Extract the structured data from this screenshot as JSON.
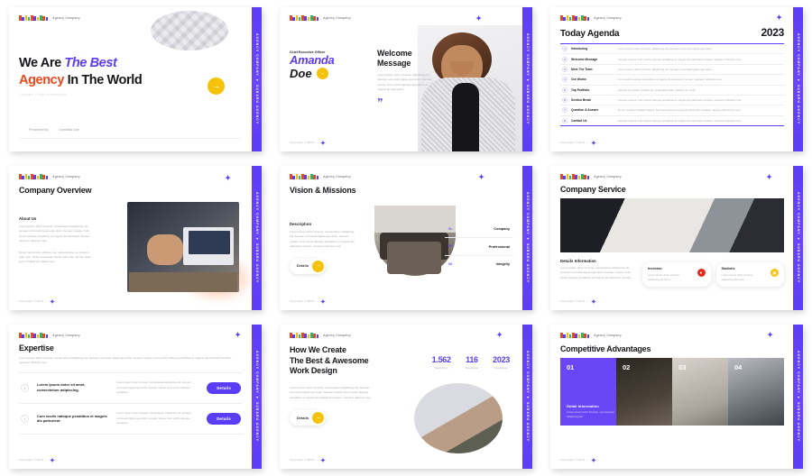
{
  "brand": {
    "name": "Agency Company",
    "logo_colors": [
      "#e8491f",
      "#5b3df5",
      "#f5c20b",
      "#2bb673",
      "#e8491f",
      "#5b3df5",
      "#f5c20b",
      "#2bb673",
      "#e8491f",
      "#5b3df5"
    ]
  },
  "rail": {
    "text": "AGENCY COMPANY  ✦  SUBARU AGENCY",
    "star": "✦",
    "color": "#5b3df5"
  },
  "common": {
    "copyright": "Copyright © 2023",
    "plus": "✦",
    "arrow": "→"
  },
  "slides": [
    {
      "id": "title-slide",
      "head_line1_a": "We Are ",
      "head_line1_b": "The Best",
      "head_line2_a": "Agency",
      "head_line2_b": " In The World",
      "subtitle": "Company Profile Presentation",
      "presented_label": "Presented by:",
      "presented_name": "Dominika Doe"
    },
    {
      "id": "welcome-slide",
      "role": "Chief Executive Officer",
      "first_name": "Amanda",
      "last_name": "Doe",
      "heading": "Welcome\nMessage",
      "body": "Lorem ipsum dolor sit amet, adipiscing elit, dolorem commodo ligula eget dolor. Aenean massa. Cum sociis natoque penatibus et magnis dis parturient.",
      "quote_glyph": "”"
    },
    {
      "id": "agenda-slide",
      "title": "Today Agenda",
      "year": "2023",
      "items": [
        {
          "n": "1",
          "label": "Introducing",
          "desc": "Lorem ipsum dolor sit amet, adipiscing elit, Aenean commodo ligula eget dolor."
        },
        {
          "n": "2",
          "label": "Welcome Message",
          "desc": "Aenean massa. Cum sociis natoque penatibus et magnis dis parturient montes, nascetur ridiculus mus."
        },
        {
          "n": "3",
          "label": "Meet The Team",
          "desc": "Lorem ipsum dolor sit amet, adipiscing elit, Aenean commodo ligula eget dolor."
        },
        {
          "n": "4",
          "label": "Our Works",
          "desc": "Cum sociis natoque penatibus et magnis dis parturient montes, nascetur ridiculus mus."
        },
        {
          "n": "5",
          "label": "Top Portfolio",
          "desc": "Aenean leo ligula, porttitor eu, consequat vitae, eleifend ac, enim."
        },
        {
          "n": "6",
          "label": "Section Break",
          "desc": "Aenean massa. Cum sociis natoque penatibus et magnis dis parturient montes, nascetur ridiculus mus."
        },
        {
          "n": "7",
          "label": "Question & Answer",
          "desc": "Donec sodales sagittis magna. Sed consequat leo egestas bibendum sodales, augue velit cursus nunc."
        },
        {
          "n": "8",
          "label": "Contact Us",
          "desc": "Aenean massa. Cum sociis natoque penatibus et magnis dis parturient montes, nascetur ridiculus mus."
        }
      ]
    },
    {
      "id": "company-overview-slide",
      "title": "Company Overview",
      "section": "About Us",
      "body1": "Lorem ipsum dolor sit amet, consectetuer adipiscing elit. Aenean commodo ligula eget dolor. Aenean massa. Cum sociis natoque penatibus et magnis dis parturient montes, nascetur ridiculus mus.",
      "body2": "Donec quam felis, ultricies nec, pellentesque eu, pretium quis, sem. Nulla consequat massa quis enim. Donec pede justo, fringilla vel, aliquet nec."
    },
    {
      "id": "vision-missions-slide",
      "title": "Vision & Missions",
      "section": "Description",
      "body": "Lorem ipsum dolor sit amet, consectetuer adipiscing elit. Aenean commodo ligula eget dolor. Aenean massa. Cum sociis natoque penatibus et magnis dis parturient montes, nascetur ridiculus mus.",
      "cta": "Details",
      "items": [
        {
          "n": "01.",
          "label": "Company"
        },
        {
          "n": "02.",
          "label": "Professional"
        },
        {
          "n": "03.",
          "label": "Integrity"
        }
      ]
    },
    {
      "id": "company-service-slide",
      "title": "Company Service",
      "section": "Details Information",
      "body": "Lorem ipsum dolor sit amet, consectetuer adipiscing elit. Aenean commodo ligula eget dolor. Aenean massa. Cum sociis natoque penatibus et magnis dis parturient montes.",
      "cards": [
        {
          "title": "Increase",
          "desc": "Lorem ipsum dolor sit amet, adipiscing elit lorem.",
          "icon": "flame-icon",
          "color": "#e8291f"
        },
        {
          "title": "Statistic",
          "desc": "Lorem ipsum dolor sit amet, adipiscing elit lorem.",
          "icon": "chart-icon",
          "color": "#f5c20b"
        }
      ]
    },
    {
      "id": "expertise-slide",
      "title": "Expertise",
      "intro": "Lorem ipsum dolor sit amet, consectetuer adipiscing elit. Aenean commodo ligula eget dolor. Aenean massa. Cum sociis natoque penatibus et magnis dis parturient montes, nascetur ridiculus mus.",
      "rows": [
        {
          "icon": "info-icon",
          "title": "Lorem ipsum dolor sit amet, consectetuer adipiscing.",
          "desc": "Lorem ipsum dolor sit amet, consectetuer adipiscing elit. Aenean commodo ligula eget dolor. Aenean massa. Cum sociis natoque penatibus.",
          "cta": "Details"
        },
        {
          "icon": "info-icon",
          "title": "Cum sociis natoque penatibus et magnis dis parturient.",
          "desc": "Lorem ipsum dolor sit amet, consectetuer adipiscing elit. Aenean commodo ligula eget dolor. Aenean massa. Cum sociis natoque penatibus.",
          "cta": "Details"
        }
      ]
    },
    {
      "id": "work-design-slide",
      "head1": "How We Create",
      "head2": "The Best & Awesome",
      "head3": "Work Design",
      "body": "Lorem ipsum dolor sit amet, consectetuer adipiscing elit. Aenean commodo ligula eget dolor. Aenean massa. Cum sociis natoque penatibus et magnis dis parturient montes, nascetur ridiculus mus.",
      "cta": "Details",
      "stats": [
        {
          "value": "1.562",
          "label": "Description"
        },
        {
          "value": "116",
          "label": "Description"
        },
        {
          "value": "2023",
          "label": "Description"
        }
      ]
    },
    {
      "id": "competitive-advantages-slide",
      "title": "Competitive Advantages",
      "panels": [
        {
          "n": "01",
          "info_title": "Detail Information",
          "info_body": "Lorem ipsum dolor sit amet, consectetuer adipiscing elit."
        },
        {
          "n": "02"
        },
        {
          "n": "03"
        },
        {
          "n": "04"
        }
      ]
    }
  ]
}
